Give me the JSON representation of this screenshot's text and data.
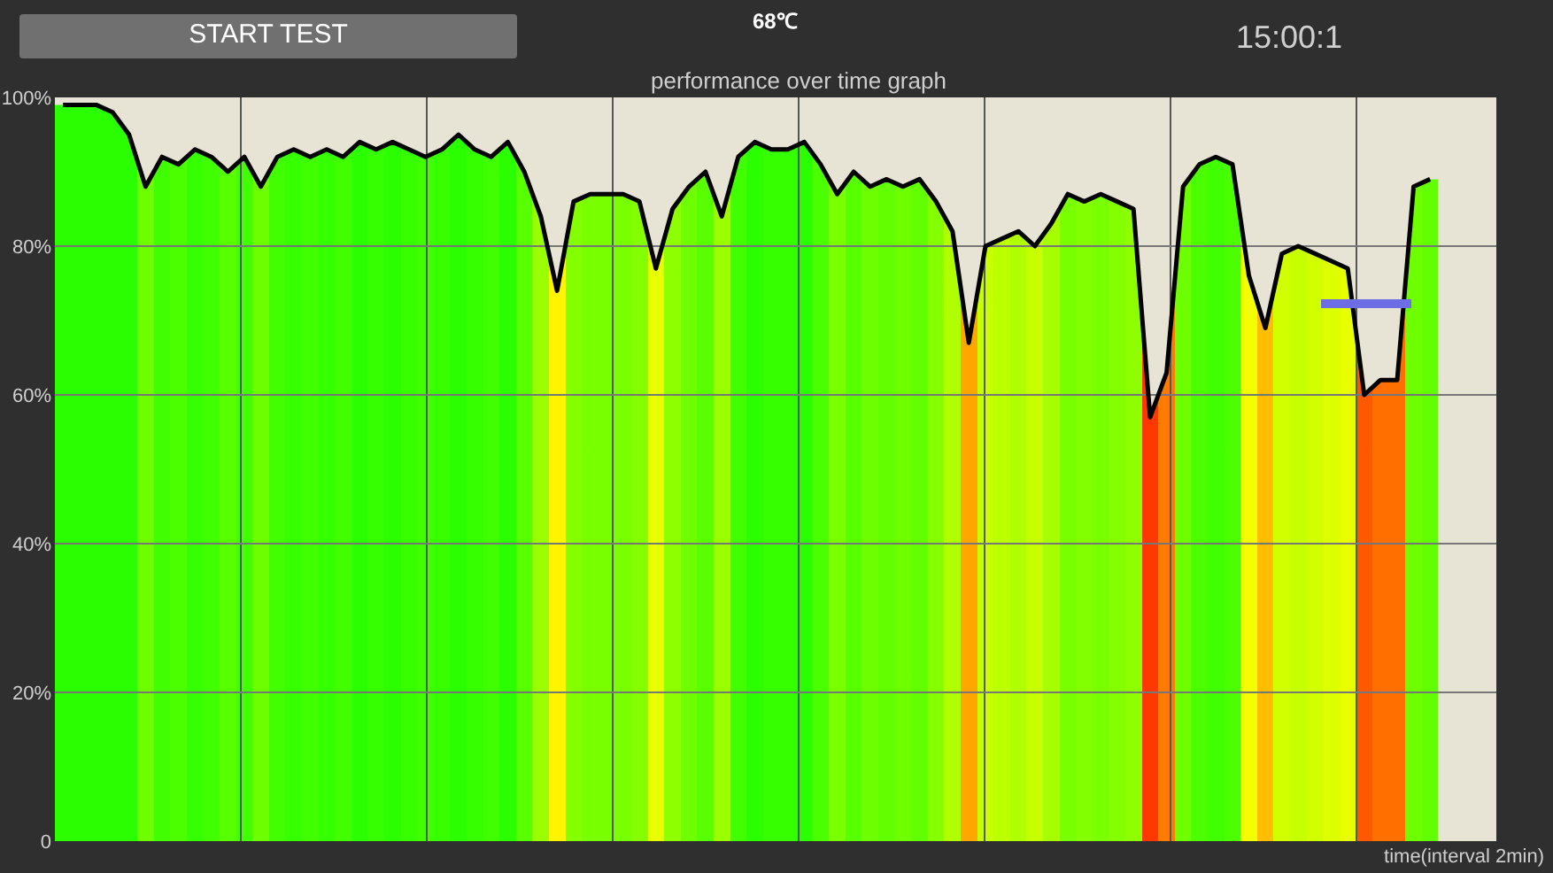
{
  "header": {
    "start_button": "START TEST",
    "temperature": "68℃",
    "timer": "15:00:1"
  },
  "chart": {
    "chart_data": {
      "type": "line",
      "grid": true,
      "title": "performance over time graph",
      "xlabel": "time(interval 2min)",
      "yticks": [
        {
          "value": 0,
          "label": "0"
        },
        {
          "value": 20,
          "label": "20%"
        },
        {
          "value": 40,
          "label": "40%"
        },
        {
          "value": 60,
          "label": "60%"
        },
        {
          "value": 80,
          "label": "80%"
        },
        {
          "value": 100,
          "label": "100%"
        }
      ],
      "ylim": [
        0,
        100
      ],
      "series": [
        {
          "color": "#000000",
          "values": [
            99,
            99,
            99,
            98,
            95,
            88,
            92,
            91,
            93,
            92,
            90,
            92,
            88,
            92,
            93,
            92,
            93,
            92,
            94,
            93,
            94,
            93,
            92,
            93,
            95,
            93,
            92,
            94,
            90,
            84,
            74,
            86,
            87,
            87,
            87,
            86,
            77,
            85,
            88,
            90,
            84,
            92,
            94,
            93,
            93,
            94,
            91,
            87,
            90,
            88,
            89,
            88,
            89,
            86,
            82,
            67,
            80,
            81,
            82,
            80,
            83,
            87,
            86,
            87,
            86,
            85,
            57,
            63,
            88,
            91,
            92,
            91,
            76,
            69,
            79,
            80,
            79,
            78,
            77,
            60,
            62,
            62,
            88,
            89
          ]
        }
      ]
    }
  }
}
